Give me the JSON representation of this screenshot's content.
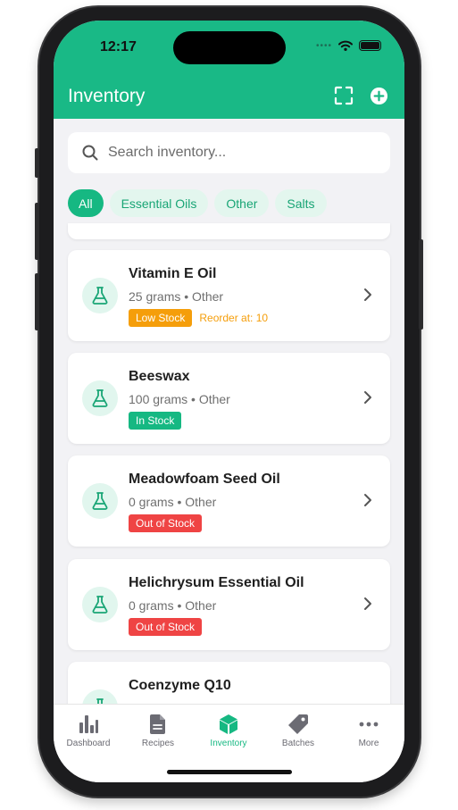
{
  "status_bar": {
    "time": "12:17",
    "signal_dots": "••••"
  },
  "header": {
    "title": "Inventory",
    "scan_icon": "scan-icon",
    "add_icon": "plus-circle-icon"
  },
  "search": {
    "placeholder": "Search inventory..."
  },
  "filters": [
    {
      "label": "All",
      "active": true
    },
    {
      "label": "Essential Oils",
      "active": false
    },
    {
      "label": "Other",
      "active": false
    },
    {
      "label": "Salts",
      "active": false
    }
  ],
  "items": [
    {
      "name": "Vitamin E Oil",
      "detail": "25 grams • Other",
      "status": "Low Stock",
      "status_color": "#f59e0b",
      "note": "Reorder at: 10"
    },
    {
      "name": "Beeswax",
      "detail": "100 grams • Other",
      "status": "In Stock",
      "status_color": "#16b882",
      "note": ""
    },
    {
      "name": "Meadowfoam Seed Oil",
      "detail": "0 grams • Other",
      "status": "Out of Stock",
      "status_color": "#ef4444",
      "note": ""
    },
    {
      "name": "Helichrysum Essential Oil",
      "detail": "0 grams • Other",
      "status": "Out of Stock",
      "status_color": "#ef4444",
      "note": ""
    },
    {
      "name": "Coenzyme Q10",
      "detail": "",
      "status": "",
      "status_color": "",
      "note": ""
    }
  ],
  "tabs": [
    {
      "label": "Dashboard",
      "icon": "bar-chart-icon"
    },
    {
      "label": "Recipes",
      "icon": "document-icon"
    },
    {
      "label": "Inventory",
      "icon": "cube-icon",
      "active": true
    },
    {
      "label": "Batches",
      "icon": "tag-icon"
    },
    {
      "label": "More",
      "icon": "more-icon"
    }
  ],
  "colors": {
    "accent": "#16b882",
    "header": "#19b986",
    "low_stock": "#f59e0b",
    "out_of_stock": "#ef4444"
  }
}
